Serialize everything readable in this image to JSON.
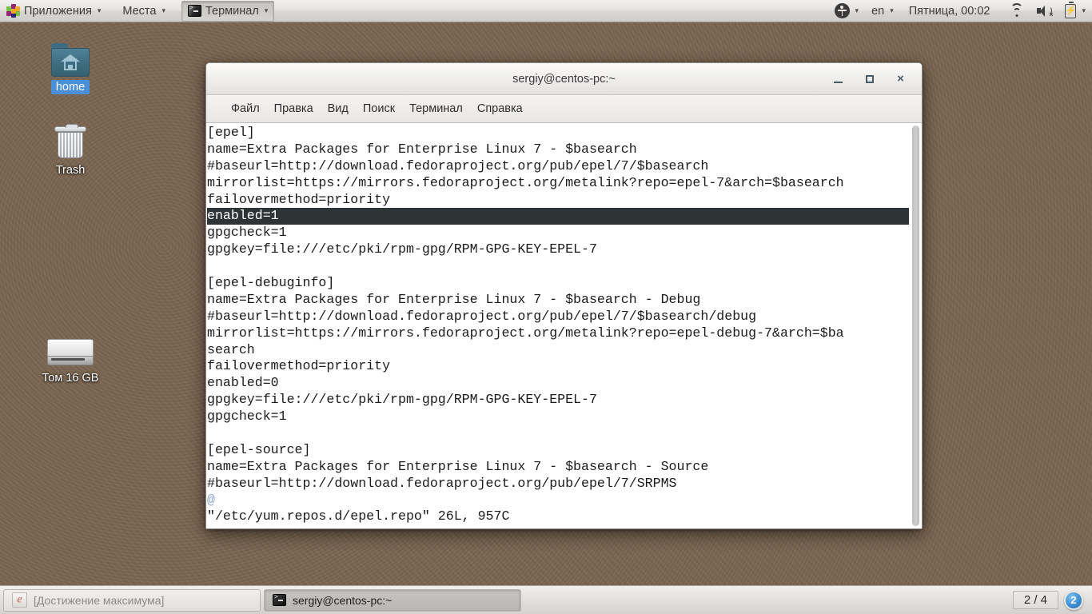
{
  "top_panel": {
    "applications_label": "Приложения",
    "places_label": "Места",
    "terminal_label": "Терминал",
    "accessibility_icon": "accessibility-icon",
    "keyboard_layout": "en",
    "clock": "Пятница, 00:02",
    "wifi_icon": "wifi-icon",
    "volume_icon": "volume-muted-icon",
    "battery_icon": "battery-charging-icon",
    "caret": "▾"
  },
  "desktop": {
    "icons": [
      {
        "name": "home",
        "label": "home",
        "icon": "home-folder-icon",
        "selected": true
      },
      {
        "name": "trash",
        "label": "Trash",
        "icon": "trash-icon",
        "selected": false
      },
      {
        "name": "volume",
        "label": "Том 16 GB",
        "icon": "drive-icon",
        "selected": false
      }
    ]
  },
  "terminal_window": {
    "title": "sergiy@centos-pc:~",
    "window_buttons": {
      "minimize": "minimize-icon",
      "maximize": "maximize-icon",
      "close": "×"
    },
    "menu": [
      "Файл",
      "Правка",
      "Вид",
      "Поиск",
      "Терминал",
      "Справка"
    ],
    "content_lines": [
      {
        "text": "[epel]",
        "highlight": false
      },
      {
        "text": "name=Extra Packages for Enterprise Linux 7 - $basearch",
        "highlight": false
      },
      {
        "text": "#baseurl=http://download.fedoraproject.org/pub/epel/7/$basearch",
        "highlight": false
      },
      {
        "text": "mirrorlist=https://mirrors.fedoraproject.org/metalink?repo=epel-7&arch=$basearch",
        "highlight": false
      },
      {
        "text": "failovermethod=priority",
        "highlight": false
      },
      {
        "text": "enabled=1",
        "highlight": true,
        "cursor": true
      },
      {
        "text": "gpgcheck=1",
        "highlight": false
      },
      {
        "text": "gpgkey=file:///etc/pki/rpm-gpg/RPM-GPG-KEY-EPEL-7",
        "highlight": false
      },
      {
        "text": "",
        "highlight": false
      },
      {
        "text": "[epel-debuginfo]",
        "highlight": false
      },
      {
        "text": "name=Extra Packages for Enterprise Linux 7 - $basearch - Debug",
        "highlight": false
      },
      {
        "text": "#baseurl=http://download.fedoraproject.org/pub/epel/7/$basearch/debug",
        "highlight": false
      },
      {
        "text": "mirrorlist=https://mirrors.fedoraproject.org/metalink?repo=epel-debug-7&arch=$ba",
        "highlight": false
      },
      {
        "text": "search",
        "highlight": false
      },
      {
        "text": "failovermethod=priority",
        "highlight": false
      },
      {
        "text": "enabled=0",
        "highlight": false
      },
      {
        "text": "gpgkey=file:///etc/pki/rpm-gpg/RPM-GPG-KEY-EPEL-7",
        "highlight": false
      },
      {
        "text": "gpgcheck=1",
        "highlight": false
      },
      {
        "text": "",
        "highlight": false
      },
      {
        "text": "[epel-source]",
        "highlight": false
      },
      {
        "text": "name=Extra Packages for Enterprise Linux 7 - $basearch - Source",
        "highlight": false
      },
      {
        "text": "#baseurl=http://download.fedoraproject.org/pub/epel/7/SRPMS",
        "highlight": false
      },
      {
        "text": "@",
        "highlight": false,
        "style": "at"
      },
      {
        "text": "\"/etc/yum.repos.d/epel.repo\" 26L, 957C",
        "highlight": false
      }
    ]
  },
  "taskbar": {
    "tasks": [
      {
        "label": "[Достижение максимума]",
        "icon": "browser-icon",
        "active": false
      },
      {
        "label": "sergiy@centos-pc:~",
        "icon": "terminal-icon",
        "active": true
      }
    ],
    "workspace_label": "2 / 4",
    "workspace_badge": "2"
  },
  "colors": {
    "selection_blue": "#4a90d9",
    "terminal_highlight": "#2e3436",
    "badge_blue": "#3d8fd1"
  }
}
